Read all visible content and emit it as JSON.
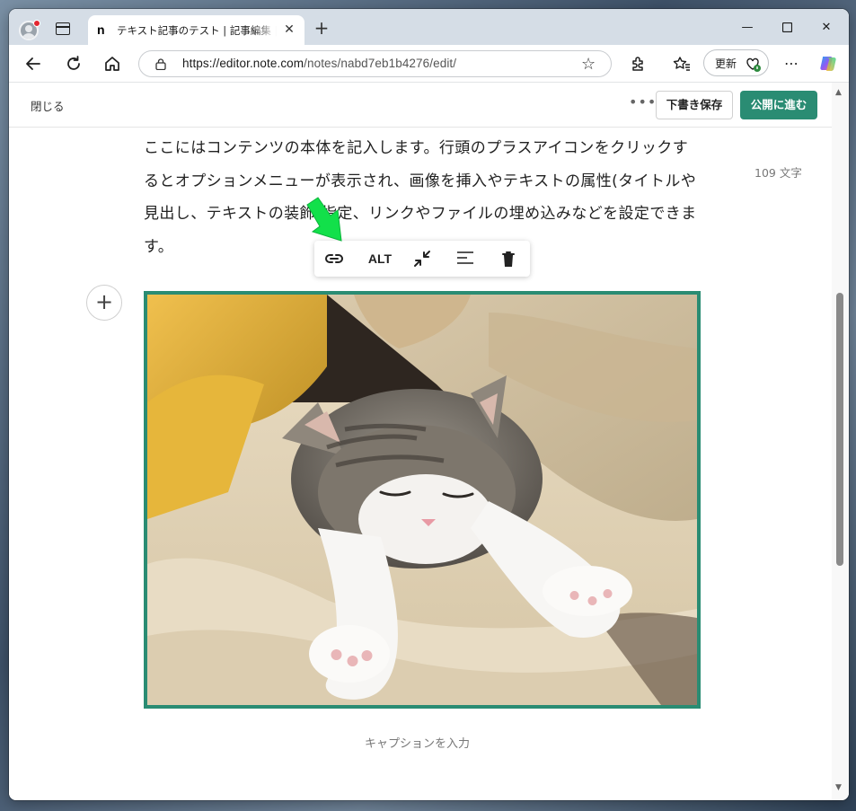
{
  "browser": {
    "tab_title": "テキスト記事のテスト | 記事編集 | note",
    "tab_favicon": "n",
    "url_host": "https://editor.note.com",
    "url_path": "/notes/nabd7eb1b4276/edit/",
    "update_label": "更新",
    "colors": {
      "tabbar": "#d5dde6",
      "profile_dot": "#e3262f"
    }
  },
  "editor": {
    "close_label": "閉じる",
    "more_label": "•••",
    "draft_label": "下書き保存",
    "publish_label": "公開に進む",
    "accent_color": "#2a8c73",
    "body_text": "ここにはコンテンツの本体を記入します。行頭のプラスアイコンをクリックするとオプションメニューが表示され、画像を挿入やテキストの属性(タイトルや見出し、テキストの装飾)指定、リンクやファイルの埋め込みなどを設定できます。",
    "char_count": "109 文字",
    "image_toolbar": {
      "link_icon": "link-icon",
      "alt_label": "ALT",
      "shrink_icon": "shrink-icon",
      "align_icon": "align-left-icon",
      "delete_icon": "trash-icon"
    },
    "add_block": "+",
    "caption_placeholder": "キャプションを入力"
  }
}
